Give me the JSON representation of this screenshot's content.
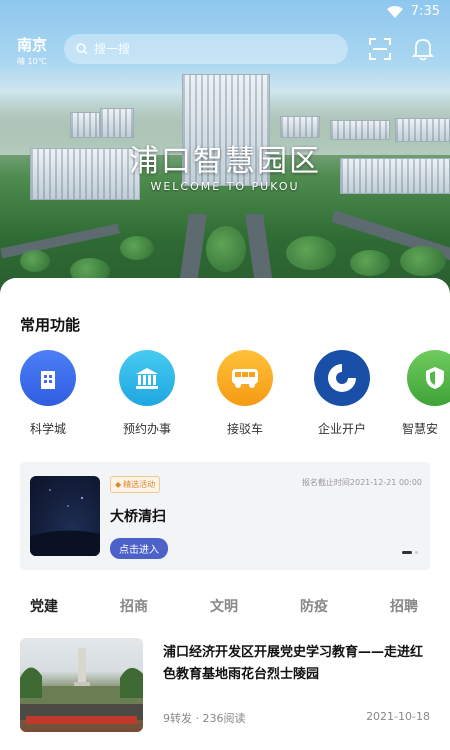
{
  "status_bar": {
    "time": "7:35"
  },
  "top_bar": {
    "city": "南京",
    "weather": "晴 10℃",
    "search_placeholder": "搜一搜"
  },
  "hero": {
    "title": "浦口智慧园区",
    "subtitle": "WELCOME TO PUKOU"
  },
  "functions": {
    "title": "常用功能",
    "items": [
      {
        "label": "科学城",
        "icon": "building-icon",
        "color": "#3d6cf0"
      },
      {
        "label": "预约办事",
        "icon": "government-icon",
        "color": "#2fb6e8"
      },
      {
        "label": "接驳车",
        "icon": "bus-icon",
        "color": "#f6a21a"
      },
      {
        "label": "企业开户",
        "icon": "ccb-logo-icon",
        "color": "#1a4fa8"
      },
      {
        "label": "智慧安",
        "icon": "shield-icon",
        "color": "#55b84a"
      }
    ]
  },
  "banner": {
    "tag": "精选活动",
    "deadline": "报名截止时间2021-12-21 00:00",
    "title": "大桥清扫",
    "button": "点击进入"
  },
  "tabs": [
    {
      "label": "党建",
      "active": true
    },
    {
      "label": "招商",
      "active": false
    },
    {
      "label": "文明",
      "active": false
    },
    {
      "label": "防疫",
      "active": false
    },
    {
      "label": "招聘",
      "active": false
    }
  ],
  "news": [
    {
      "title": "浦口经济开发区开展党史学习教育——走进红色教育基地雨花台烈士陵园",
      "meta": "9转发 · 236阅读",
      "date": "2021-10-18"
    }
  ]
}
